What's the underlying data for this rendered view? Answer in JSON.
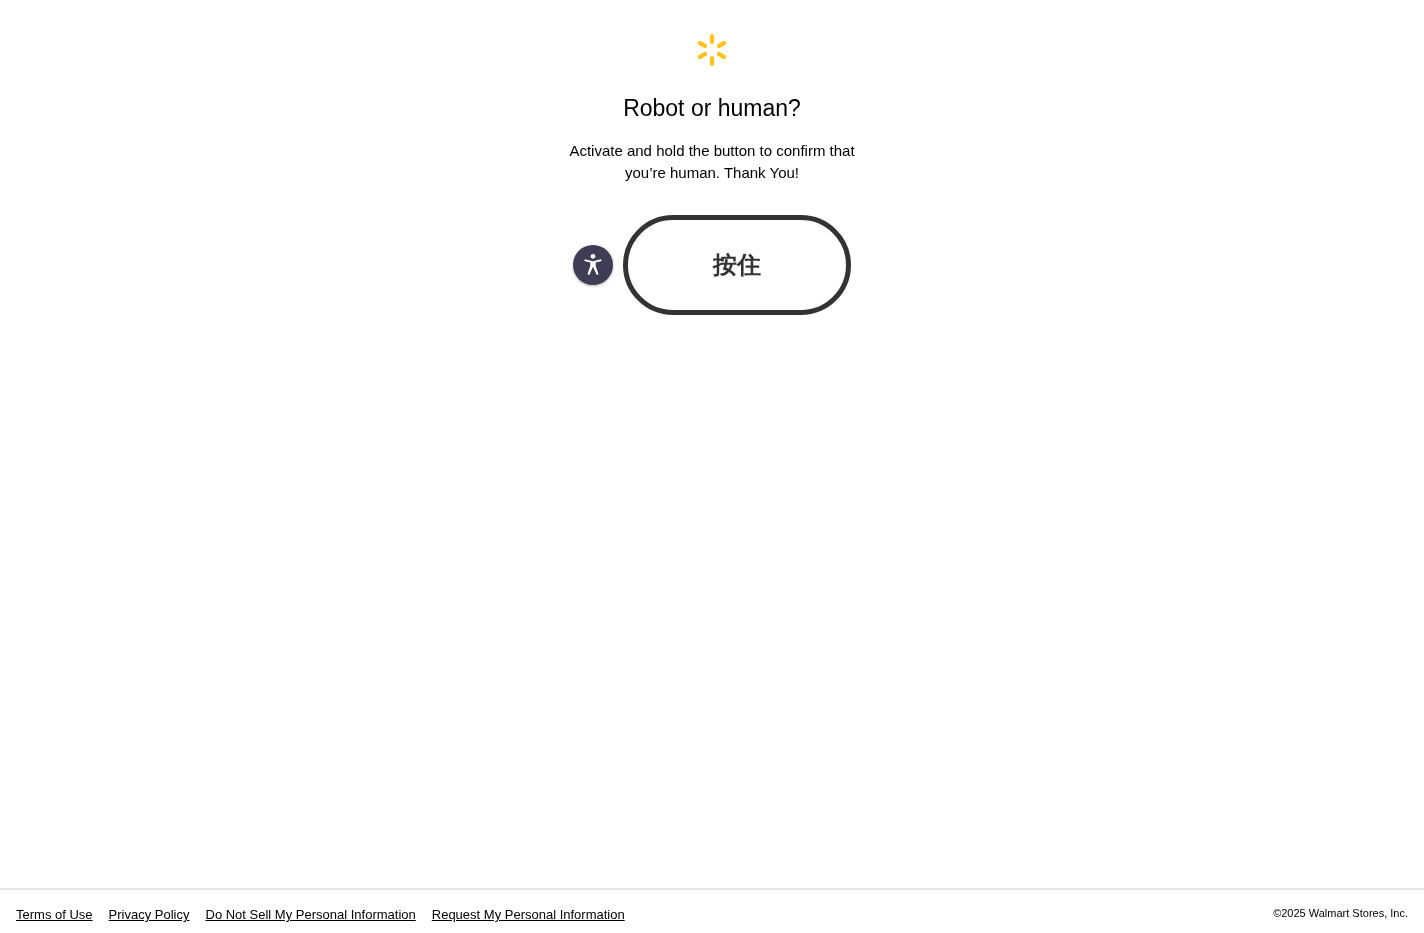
{
  "heading": "Robot or human?",
  "message": "Activate and hold the button to confirm that you’re human. Thank You!",
  "hold_button": {
    "label": "按住"
  },
  "footer": {
    "links": [
      "Terms of Use",
      "Privacy Policy",
      "Do Not Sell My Personal Information",
      "Request My Personal Information"
    ],
    "copyright": "©2025 Walmart Stores, Inc."
  }
}
